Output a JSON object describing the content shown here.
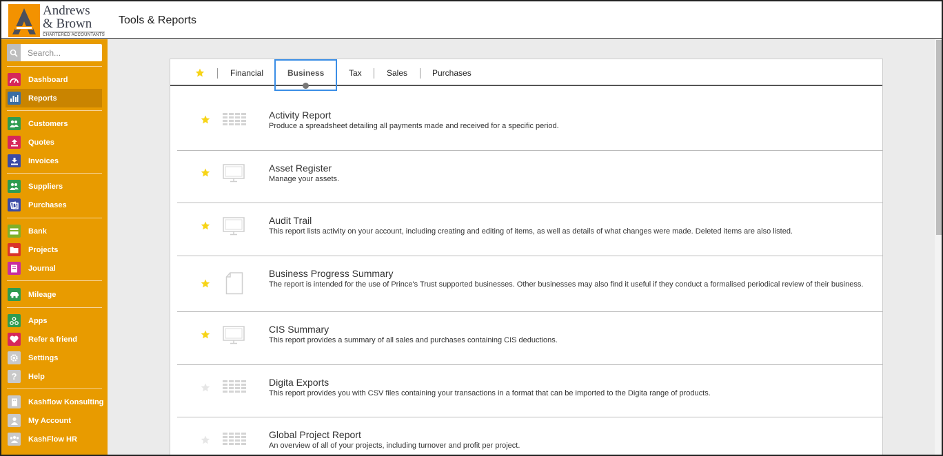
{
  "header": {
    "logo_line1": "Andrews",
    "logo_line2": "& Brown",
    "logo_tagline": "CHARTERED ACCOUNTANTS",
    "page_title": "Tools & Reports"
  },
  "sidebar": {
    "search_placeholder": "Search...",
    "items": [
      {
        "label": "Dashboard",
        "icon": "gauge-icon",
        "color": "#d6275a"
      },
      {
        "label": "Reports",
        "icon": "bar-chart-icon",
        "color": "#3a6ea5"
      },
      {
        "label": "Customers",
        "icon": "people-icon",
        "color": "#2e9b4f"
      },
      {
        "label": "Quotes",
        "icon": "upload-icon",
        "color": "#d6275a"
      },
      {
        "label": "Invoices",
        "icon": "download-icon",
        "color": "#3a4aa5"
      },
      {
        "label": "Suppliers",
        "icon": "people-icon",
        "color": "#2e9b4f"
      },
      {
        "label": "Purchases",
        "icon": "purchases-icon",
        "color": "#3a4aa5"
      },
      {
        "label": "Bank",
        "icon": "card-icon",
        "color": "#7fb02a"
      },
      {
        "label": "Projects",
        "icon": "folder-icon",
        "color": "#d9342b"
      },
      {
        "label": "Journal",
        "icon": "book-icon",
        "color": "#c72fa0"
      },
      {
        "label": "Mileage",
        "icon": "car-icon",
        "color": "#2e9b4f"
      },
      {
        "label": "Apps",
        "icon": "apps-icon",
        "color": "#2e9b4f"
      },
      {
        "label": "Refer a friend",
        "icon": "heart-icon",
        "color": "#d6275a"
      },
      {
        "label": "Settings",
        "icon": "gear-icon",
        "color": "#c9c9c9"
      },
      {
        "label": "Help",
        "icon": "question-icon",
        "color": "#c9c9c9"
      },
      {
        "label": "Kashflow Konsulting",
        "icon": "building-icon",
        "color": "#c9c9c9"
      },
      {
        "label": "My Account",
        "icon": "user-icon",
        "color": "#c9c9c9"
      },
      {
        "label": "KashFlow HR",
        "icon": "group-icon",
        "color": "#c9c9c9"
      }
    ]
  },
  "tabs": [
    "Financial",
    "Business",
    "Tax",
    "Sales",
    "Purchases"
  ],
  "selected_tab": "Business",
  "reports": [
    {
      "title": "Activity Report",
      "desc": "Produce a spreadsheet detailing all payments made and received for a specific period.",
      "favorite": true,
      "icon": "spreadsheet-icon"
    },
    {
      "title": "Asset Register",
      "desc": "Manage your assets.",
      "favorite": true,
      "icon": "monitor-icon"
    },
    {
      "title": "Audit Trail",
      "desc": "This report lists activity on your account, including creating and editing of items, as well as details of what changes were made. Deleted items are also listed.",
      "favorite": true,
      "icon": "monitor-icon"
    },
    {
      "title": "Business Progress Summary",
      "desc": "The report is intended for the use of Prince's Trust supported businesses. Other businesses may also find it useful if they conduct a formalised periodical review of their business.",
      "favorite": true,
      "icon": "document-icon"
    },
    {
      "title": "CIS Summary",
      "desc": "This report provides a summary of all sales and purchases containing CIS deductions.",
      "favorite": true,
      "icon": "monitor-icon"
    },
    {
      "title": "Digita Exports",
      "desc": "This report provides you with CSV files containing your transactions in a format that can be imported to the Digita range of products.",
      "favorite": false,
      "icon": "spreadsheet-icon"
    },
    {
      "title": "Global Project Report",
      "desc": "An overview of all of your projects, including turnover and profit per project.",
      "favorite": false,
      "icon": "spreadsheet-icon"
    }
  ],
  "colors": {
    "sidebar": "#e89b00",
    "accent": "#f39200",
    "selected_tab_border": "#3a8ee6",
    "star_on": "#f7d417",
    "star_off": "#e6e6e6"
  }
}
